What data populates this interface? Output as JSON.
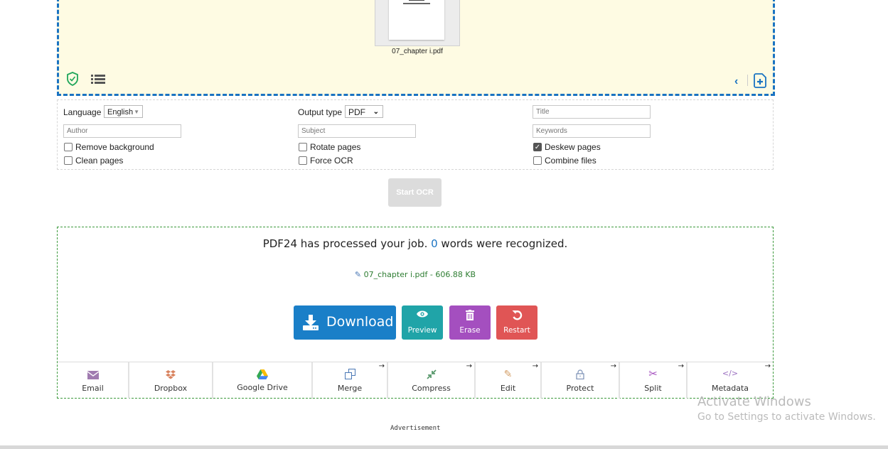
{
  "upload": {
    "file_name": "07_chapter i.pdf"
  },
  "icons": {
    "shield": "shield-check-icon",
    "list": "list-icon",
    "prev": "chevron-left-icon",
    "add_file": "file-plus-icon"
  },
  "options": {
    "language_label": "Language",
    "language_value": "English",
    "output_type_label": "Output type",
    "output_type_value": "PDF",
    "title_placeholder": "Title",
    "author_placeholder": "Author",
    "subject_placeholder": "Subject",
    "keywords_placeholder": "Keywords",
    "checkboxes": [
      {
        "label": "Remove background",
        "checked": false
      },
      {
        "label": "Clean pages",
        "checked": false
      },
      {
        "label": "Rotate pages",
        "checked": false
      },
      {
        "label": "Force OCR",
        "checked": false
      },
      {
        "label": "Deskew pages",
        "checked": true
      },
      {
        "label": "Combine files",
        "checked": false
      }
    ]
  },
  "start_button": "Start OCR",
  "result": {
    "msg_before": "PDF24 has processed your job. ",
    "word_count": "0",
    "msg_after": " words were recognized.",
    "file_line": "07_chapter i.pdf - 606.88 KB",
    "buttons": {
      "download": "Download",
      "preview": "Preview",
      "erase": "Erase",
      "restart": "Restart"
    },
    "tools": [
      {
        "label": "Email",
        "icon": "envelope-icon",
        "arrow": false
      },
      {
        "label": "Dropbox",
        "icon": "dropbox-icon",
        "arrow": false
      },
      {
        "label": "Google Drive",
        "icon": "google-drive-icon",
        "arrow": false
      },
      {
        "label": "Merge",
        "icon": "merge-icon",
        "arrow": true
      },
      {
        "label": "Compress",
        "icon": "compress-icon",
        "arrow": true
      },
      {
        "label": "Edit",
        "icon": "pencil-icon",
        "arrow": true
      },
      {
        "label": "Protect",
        "icon": "lock-icon",
        "arrow": true
      },
      {
        "label": "Split",
        "icon": "scissors-icon",
        "arrow": true
      },
      {
        "label": "Metadata",
        "icon": "code-icon",
        "arrow": true
      }
    ],
    "arrow_glyph": "→"
  },
  "advertisement": "Advertisement",
  "watermark": {
    "title": "Activate Windows",
    "subtitle": "Go to Settings to activate Windows."
  },
  "colors": {
    "accent": "#1a73c2",
    "download": "#1a7fc8",
    "preview": "#20a4a8",
    "erase": "#a44fbf",
    "restart": "#e05555",
    "success_text": "#2e7d32",
    "dropzone_bg": "#fefbe3"
  }
}
